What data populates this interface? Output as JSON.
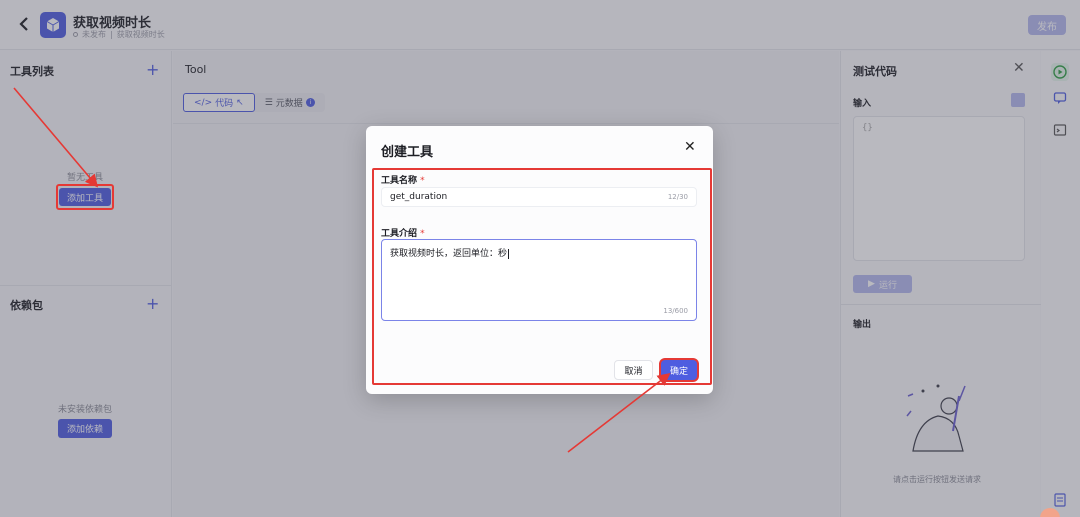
{
  "header": {
    "title": "获取视频时长",
    "status": "未发布",
    "breadcrumb": "获取视频时长",
    "publish_label": "发布",
    "icons": {
      "back": "chevron-left-icon",
      "logo": "cube-icon"
    }
  },
  "left": {
    "tools_title": "工具列表",
    "tools_empty": "暂无工具",
    "add_tool_label": "添加工具",
    "deps_title": "依赖包",
    "deps_empty": "未安装依赖包",
    "add_dep_label": "添加依赖"
  },
  "center": {
    "tool_label": "Tool",
    "tabs": [
      {
        "label": "代码",
        "icon": "code-icon"
      },
      {
        "label": "元数据",
        "icon": "metadata-icon"
      }
    ]
  },
  "right": {
    "title": "测试代码",
    "input_label": "输入",
    "input_value": "{}",
    "run_label": "运行",
    "output_label": "输出",
    "hint": "请点击运行按钮发送请求"
  },
  "modal": {
    "title": "创建工具",
    "name_label": "工具名称",
    "name_value": "get_duration",
    "name_counter": "12/30",
    "desc_label": "工具介绍",
    "desc_value": "获取视频时长，返回单位：秒",
    "desc_counter": "13/600",
    "required_mark": "*",
    "cancel_label": "取消",
    "confirm_label": "确定"
  },
  "colors": {
    "accent": "#4e5de0",
    "highlight": "#e53935"
  }
}
